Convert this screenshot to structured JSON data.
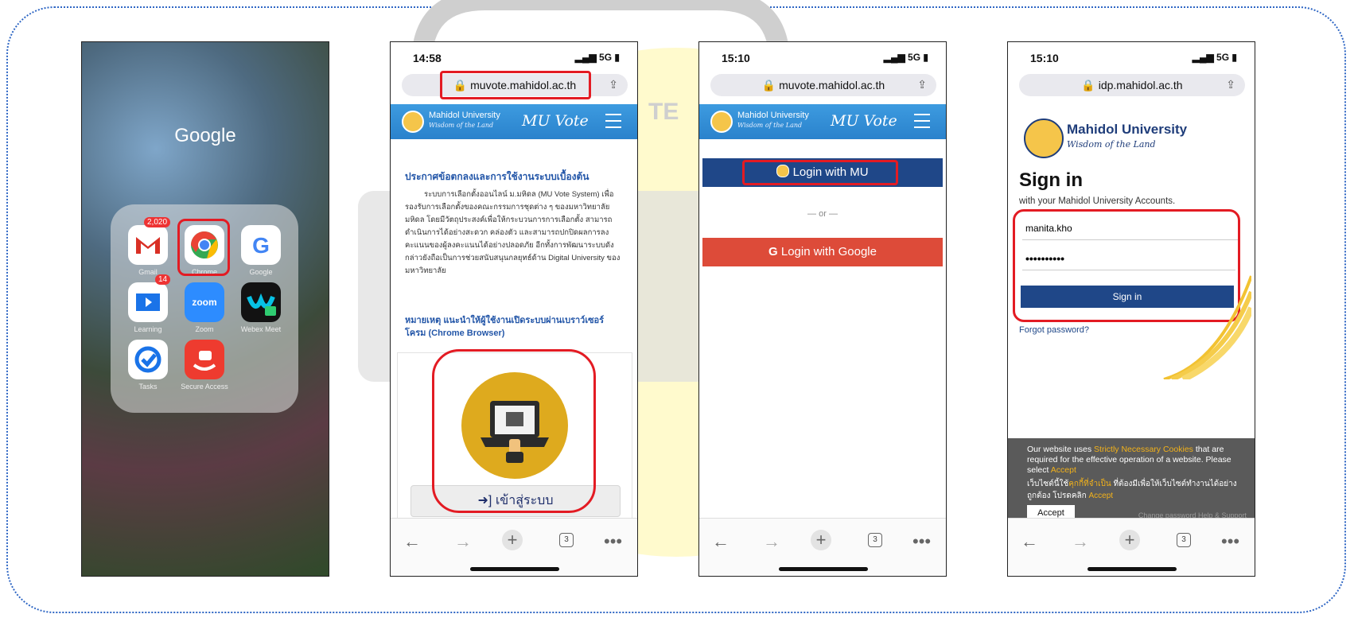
{
  "phones": {
    "home": {
      "folder_title": "Google",
      "apps": [
        {
          "label": "Gmail",
          "badge": "2,020",
          "icon": "gmail-icon"
        },
        {
          "label": "Chrome",
          "icon": "chrome-icon"
        },
        {
          "label": "Google",
          "icon": "google-icon"
        },
        {
          "label": "Learning",
          "badge": "14",
          "icon": "learning-icon"
        },
        {
          "label": "Zoom",
          "glyph": "zoom",
          "icon": "zoom-icon"
        },
        {
          "label": "Webex Meet",
          "icon": "webex-icon"
        },
        {
          "label": "Tasks",
          "icon": "tasks-icon"
        },
        {
          "label": "Secure Access",
          "icon": "secure-access-icon"
        }
      ]
    },
    "muvote_home": {
      "time": "14:58",
      "signal": "5G",
      "url": "muvote.mahidol.ac.th",
      "brand": "Mahidol University",
      "tagline": "Wisdom of the Land",
      "app_title": "MU Vote",
      "notice_title": "ประกาศข้อตกลงและการใช้งานระบบเบื้องต้น",
      "notice_body": "ระบบการเลือกตั้งออนไลน์ ม.มหิดล (MU Vote System) เพื่อรองรับการเลือกตั้งของคณะกรรมการชุดต่าง ๆ ของมหาวิทยาลัยมหิดล โดยมีวัตถุประสงค์เพื่อให้กระบวนการการเลือกตั้ง สามารถดำเนินการได้อย่างสะดวก คล่องตัว และสามารถปกปิดผลการลงคะแนนของผู้ลงคะแนนได้อย่างปลอดภัย อีกทั้งการพัฒนาระบบดังกล่าวยังถือเป็นการช่วยสนับสนุนกลยุทธ์ด้าน Digital University ของมหาวิทยาลัย",
      "note": "หมายเหตุ แนะนำให้ผู้ใช้งานเปิดระบบผ่านเบราว์เซอร์โครม (Chrome Browser)",
      "login_button": "เข้าสู่ระบบ",
      "tabs": "3"
    },
    "muvote_login": {
      "time": "15:10",
      "signal": "5G",
      "url": "muvote.mahidol.ac.th",
      "brand": "Mahidol University",
      "tagline": "Wisdom of the Land",
      "app_title": "MU Vote",
      "login_mu": "Login with MU",
      "or": "— or —",
      "login_google": "Login with Google",
      "tabs": "3"
    },
    "idp": {
      "time": "15:10",
      "signal": "5G",
      "url": "idp.mahidol.ac.th",
      "brand": "Mahidol University",
      "tagline": "Wisdom of the Land",
      "heading": "Sign in",
      "subheading": "with your Mahidol University Accounts.",
      "username": "manita.kho",
      "password": "••••••••••",
      "signin_button": "Sign in",
      "forgot": "Forgot password?",
      "cookie_en_1": "Our website uses ",
      "cookie_en_link": "Strictly Necessary Cookies",
      "cookie_en_2": " that are required for the effective operation of a website. Please select ",
      "cookie_en_accept": "Accept",
      "cookie_th_1": "เว็บไซต์นี้ใช้",
      "cookie_th_link": "คุกกี้ที่จำเป็น",
      "cookie_th_2": " ที่ต้องมีเพื่อให้เว็บไซต์ทำงานได้อย่างถูกต้อง โปรดคลิก ",
      "cookie_th_accept": "Accept",
      "accept_button": "Accept",
      "footer_links": "Change password   Help & Support",
      "tabs": "3"
    }
  },
  "background_watermark": "TE",
  "colors": {
    "highlight": "#e31b23",
    "mu_blue": "#2a82cc",
    "navy": "#1f4788",
    "google_red": "#dd4b39",
    "border_dots": "#2e66c4"
  }
}
